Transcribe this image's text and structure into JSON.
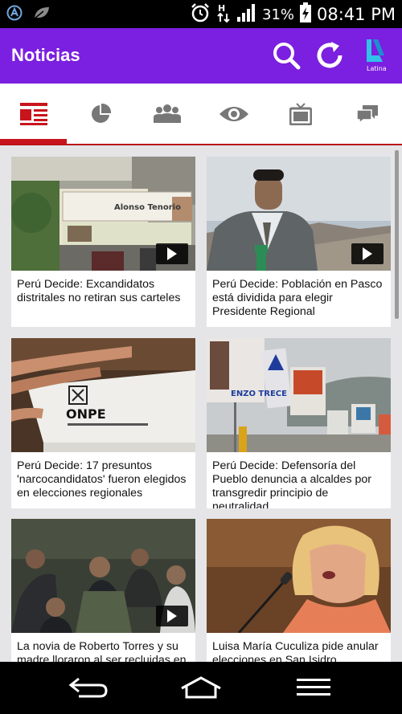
{
  "status_bar": {
    "battery_percent": "31%",
    "time": "08:41 PM",
    "network_type": "H",
    "icons": [
      "app-notification-icon",
      "leaf-icon",
      "alarm-icon",
      "network-h-icon",
      "signal-icon",
      "battery-charging-icon"
    ]
  },
  "app_bar": {
    "title": "Noticias",
    "actions": [
      "search-icon",
      "refresh-icon",
      "latina-logo"
    ],
    "logo_text": "Latina",
    "color": "#7b1fe0"
  },
  "tabs": [
    {
      "icon": "news-icon",
      "active": true
    },
    {
      "icon": "pie-chart-icon",
      "active": false
    },
    {
      "icon": "people-icon",
      "active": false
    },
    {
      "icon": "eye-icon",
      "active": false
    },
    {
      "icon": "tv-icon",
      "active": false
    },
    {
      "icon": "chat-icon",
      "active": false
    }
  ],
  "accent_color": "#c8141c",
  "news": [
    {
      "title": "Perú Decide: Excandidatos distritales no retiran sus carteles",
      "video": true,
      "banner_text": "Alonso Tenorio"
    },
    {
      "title": "Perú Decide: Población en Pasco está dividida para elegir Presidente Regional",
      "video": true
    },
    {
      "title": "Perú Decide: 17 presuntos 'narcocandidatos' fueron elegidos en elecciones regionales",
      "video": false,
      "banner_text": "ONPE"
    },
    {
      "title": "Perú Decide: Defensoría del Pueblo denuncia a alcaldes por transgredir principio de neutralidad",
      "video": false,
      "banner_text": "ENZO TRECE"
    },
    {
      "title": "La novia de Roberto Torres y su madre lloraron al ser recluidas en",
      "video": true
    },
    {
      "title": "Luisa María Cuculiza pide anular elecciones en San Isidro",
      "video": false
    }
  ],
  "nav_bar": [
    "back-icon",
    "home-icon",
    "menu-icon"
  ]
}
